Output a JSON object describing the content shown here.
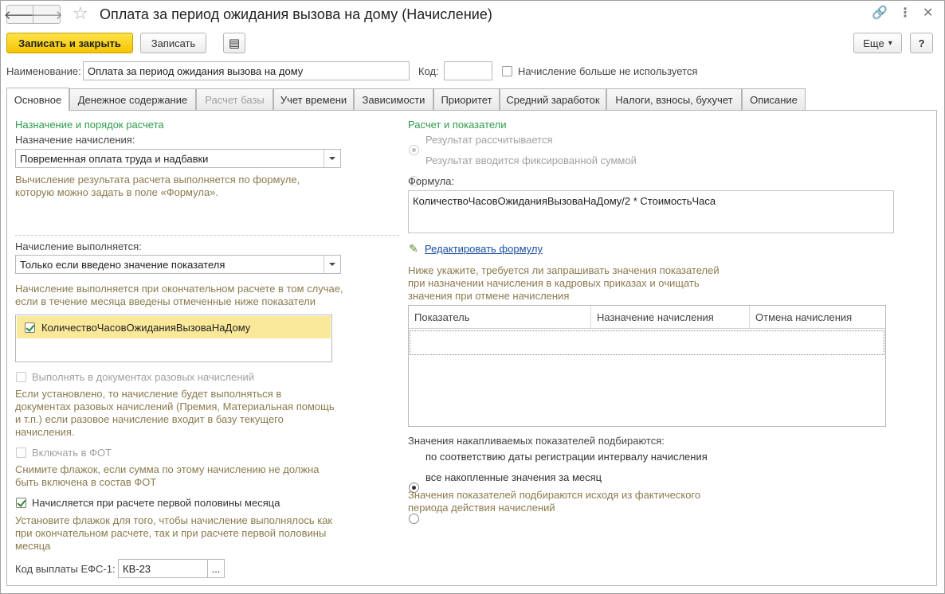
{
  "window": {
    "title": "Оплата за период ожидания вызова на дому (Начисление)",
    "back_glyph": "🡐",
    "forward_glyph": "🡒",
    "star_glyph": "☆",
    "link_glyph": "🔗",
    "more_glyph": "⋮",
    "close_glyph": "✕"
  },
  "toolbar": {
    "save_close_label": "Записать и закрыть",
    "save_label": "Записать",
    "report_glyph": "▤",
    "more_label": "Еще",
    "more_arrow": "▾",
    "help_label": "?"
  },
  "header": {
    "name_label": "Наименование:",
    "name_value": "Оплата за период ожидания вызова на дому",
    "code_label": "Код:",
    "code_value": "",
    "unused_label": "Начисление больше не используется"
  },
  "tabs": [
    {
      "label": "Основное"
    },
    {
      "label": "Денежное содержание"
    },
    {
      "label": "Расчет базы"
    },
    {
      "label": "Учет времени"
    },
    {
      "label": "Зависимости"
    },
    {
      "label": "Приоритет"
    },
    {
      "label": "Средний заработок"
    },
    {
      "label": "Налоги, взносы, бухучет"
    },
    {
      "label": "Описание"
    }
  ],
  "left": {
    "section_title": "Назначение и порядок расчета",
    "purpose_label": "Назначение начисления:",
    "purpose_value": "Повременная оплата труда и надбавки",
    "purpose_hint_1": "Вычисление результата расчета выполняется по формуле,",
    "purpose_hint_2": "которую можно задать в поле «Формула».",
    "performed_label": "Начисление выполняется:",
    "performed_value": "Только если введено значение показателя",
    "performed_hint_1": "Начисление выполняется при окончательном расчете в том случае,",
    "performed_hint_2": "если в течение месяца введены отмеченные ниже показатели",
    "indicator_item": "КоличествоЧасовОжиданияВызоваНаДому",
    "one_time_label": "Выполнять в документах разовых начислений",
    "one_time_hint_1": "Если установлено, то начисление будет выполняться в",
    "one_time_hint_2": "документах разовых начислений (Премия, Материальная помощь",
    "one_time_hint_3": "и т.п.) если разовое начисление входит в базу текущего",
    "one_time_hint_4": "начисления.",
    "fot_label": "Включать в ФОТ",
    "fot_hint_1": "Снимите флажок, если сумма по этому начислению не должна",
    "fot_hint_2": "быть включена в состав ФОТ",
    "first_half_label": "Начисляется при расчете первой половины месяца",
    "first_half_hint_1": "Установите флажок для того, чтобы начисление выполнялось как",
    "first_half_hint_2": "при окончательном расчете, так и при расчете первой половины",
    "first_half_hint_3": "месяца",
    "efs_label": "Код выплаты ЕФС-1:",
    "efs_value": "КВ-23",
    "efs_button": "..."
  },
  "right": {
    "section_title": "Расчет и показатели",
    "radio_calculated": "Результат рассчитывается",
    "radio_fixed": "Результат вводится фиксированной суммой",
    "formula_label": "Формула:",
    "formula_value": "КоличествоЧасовОжиданияВызоваНаДому/2 * СтоимостьЧаса",
    "edit_formula_link": "Редактировать формулу",
    "edit_icon_glyph": "✎",
    "request_hint_1": "Ниже укажите, требуется ли запрашивать значения показателей",
    "request_hint_2": "при назначении начисления в кадровых приказах и очищать",
    "request_hint_3": "значения при отмене начисления",
    "grid_columns": [
      "Показатель",
      "Назначение начисления",
      "Отмена начисления"
    ],
    "accum_label": "Значения накапливаемых показателей подбираются:",
    "radio_by_date": "по соответствию даты регистрации интервалу начисления",
    "radio_all_month": "все накопленные значения за месяц",
    "accum_hint_1": "Значения показателей подбираются исходя из фактического",
    "accum_hint_2": "периода действия начислений"
  },
  "colors": {
    "accent_yellow": "#f4c400",
    "section_green": "#2d9c4a",
    "hint_brown": "#8a7a4d",
    "selected_row": "#fbe99a",
    "link_blue": "#1a4fa0"
  }
}
